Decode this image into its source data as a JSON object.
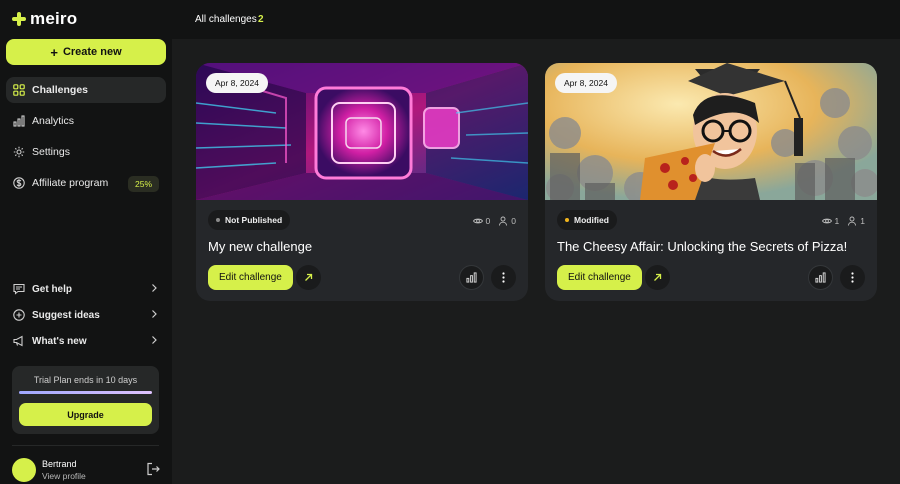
{
  "brand": {
    "name": "meiro",
    "accent": "#d6f04a"
  },
  "sidebar": {
    "create_label": "Create new",
    "nav": [
      {
        "label": "Challenges",
        "icon": "grid-icon",
        "active": true
      },
      {
        "label": "Analytics",
        "icon": "bar-chart-icon"
      },
      {
        "label": "Settings",
        "icon": "gear-icon"
      },
      {
        "label": "Affiliate program",
        "icon": "dollar-icon",
        "badge": "25%"
      }
    ],
    "help": [
      {
        "label": "Get help",
        "icon": "chat-icon"
      },
      {
        "label": "Suggest ideas",
        "icon": "plus-circle-icon"
      },
      {
        "label": "What's new",
        "icon": "megaphone-icon"
      }
    ],
    "trial": {
      "text": "Trial Plan ends in 10 days",
      "upgrade_label": "Upgrade"
    },
    "user": {
      "name": "Bertrand",
      "link": "View profile"
    }
  },
  "header": {
    "title": "All challenges",
    "count": "2"
  },
  "cards": [
    {
      "date": "Apr 8, 2024",
      "status": "Not Published",
      "status_color": "#8a8a8a",
      "views": "0",
      "participants": "0",
      "title": "My new challenge",
      "edit_label": "Edit challenge"
    },
    {
      "date": "Apr 8, 2024",
      "status": "Modified",
      "status_color": "#f2b51c",
      "views": "1",
      "participants": "1",
      "title": "The Cheesy Affair: Unlocking the Secrets of Pizza!",
      "edit_label": "Edit challenge"
    }
  ]
}
